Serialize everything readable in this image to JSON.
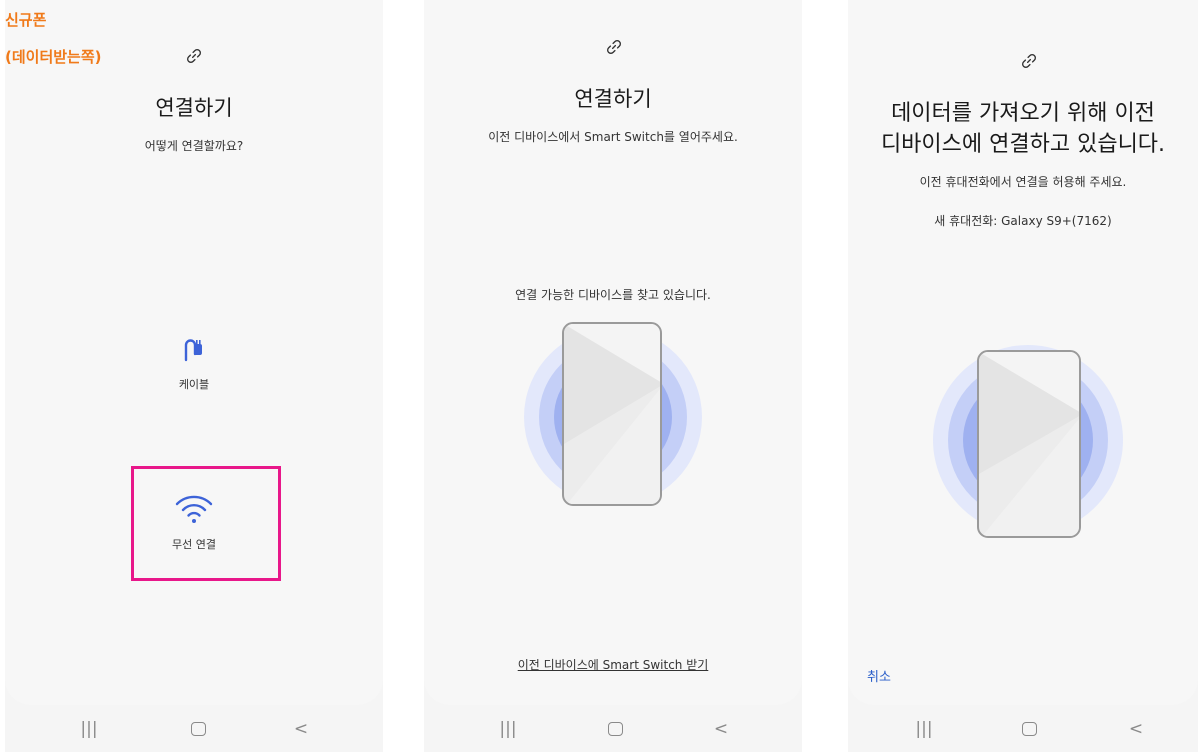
{
  "annotation": {
    "line1": "신규폰",
    "line2": "(데이터받는쪽)"
  },
  "screen1": {
    "title": "연결하기",
    "subtitle": "어떻게 연결할까요?",
    "options": [
      {
        "label": "케이블",
        "icon": "cable-icon"
      },
      {
        "label": "무선 연결",
        "icon": "wifi-icon"
      }
    ],
    "highlighted_option": "무선 연결"
  },
  "screen2": {
    "title": "연결하기",
    "subtitle": "이전 디바이스에서 Smart Switch를 열어주세요.",
    "status": "연결 가능한 디바이스를 찾고 있습니다.",
    "bottom_link": "이전 디바이스에 Smart Switch 받기"
  },
  "screen3": {
    "title_line1": "데이터를 가져오기 위해 이전",
    "title_line2": "디바이스에 연결하고 있습니다.",
    "subtitle": "이전 휴대전화에서 연결을 허용해 주세요.",
    "device_info": "새 휴대전화: Galaxy S9+(7162)",
    "cancel_label": "취소"
  },
  "navbar": {
    "recent_icon": "recent-apps-icon",
    "home_icon": "home-icon",
    "back_icon": "back-icon"
  },
  "colors": {
    "accent_blue": "#2a5ec9",
    "icon_blue": "#3d63d8",
    "highlight_pink": "#e8178a",
    "annotation_orange": "#f07a1a"
  }
}
